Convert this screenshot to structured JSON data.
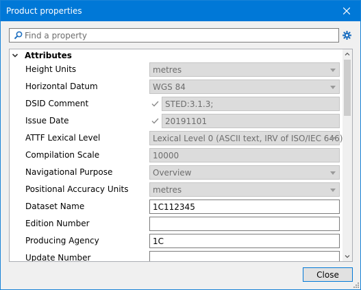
{
  "window": {
    "title": "Product properties"
  },
  "search": {
    "placeholder": "Find a property"
  },
  "grid": {
    "category": "Attributes",
    "rows": [
      {
        "label": "Height Units",
        "value": "metres",
        "type": "dropdown",
        "state": "disabled"
      },
      {
        "label": "Horizontal Datum",
        "value": "WGS 84",
        "type": "dropdown",
        "state": "disabled"
      },
      {
        "label": "DSID Comment",
        "value": "STED:3.1.3;",
        "type": "checked-text",
        "state": "disabled"
      },
      {
        "label": "Issue Date",
        "value": "20191101",
        "type": "checked-text",
        "state": "disabled"
      },
      {
        "label": "ATTF Lexical Level",
        "value": "Lexical Level 0 (ASCII text, IRV of ISO/IEC 646)",
        "type": "dropdown",
        "state": "disabled"
      },
      {
        "label": "Compilation Scale",
        "value": "10000",
        "type": "text",
        "state": "disabled"
      },
      {
        "label": "Navigational Purpose",
        "value": "Overview",
        "type": "dropdown",
        "state": "disabled"
      },
      {
        "label": "Positional Accuracy Units",
        "value": "metres",
        "type": "dropdown",
        "state": "disabled"
      },
      {
        "label": "Dataset Name",
        "value": "1C112345",
        "type": "text",
        "state": "editable"
      },
      {
        "label": "Edition Number",
        "value": "",
        "type": "text",
        "state": "editable"
      },
      {
        "label": "Producing Agency",
        "value": "1C",
        "type": "text",
        "state": "editable"
      },
      {
        "label": "Update Number",
        "value": "",
        "type": "text",
        "state": "editable"
      }
    ]
  },
  "footer": {
    "close_label": "Close"
  },
  "colors": {
    "titlebar": "#0078d7",
    "disabled_field": "#dcdcdc",
    "accent": "#0078d7"
  },
  "icons": {
    "search": "search-icon",
    "gear": "gear-icon",
    "close": "close-icon",
    "collapse": "chevron-down-icon",
    "dropdown": "dropdown-arrow-icon"
  }
}
